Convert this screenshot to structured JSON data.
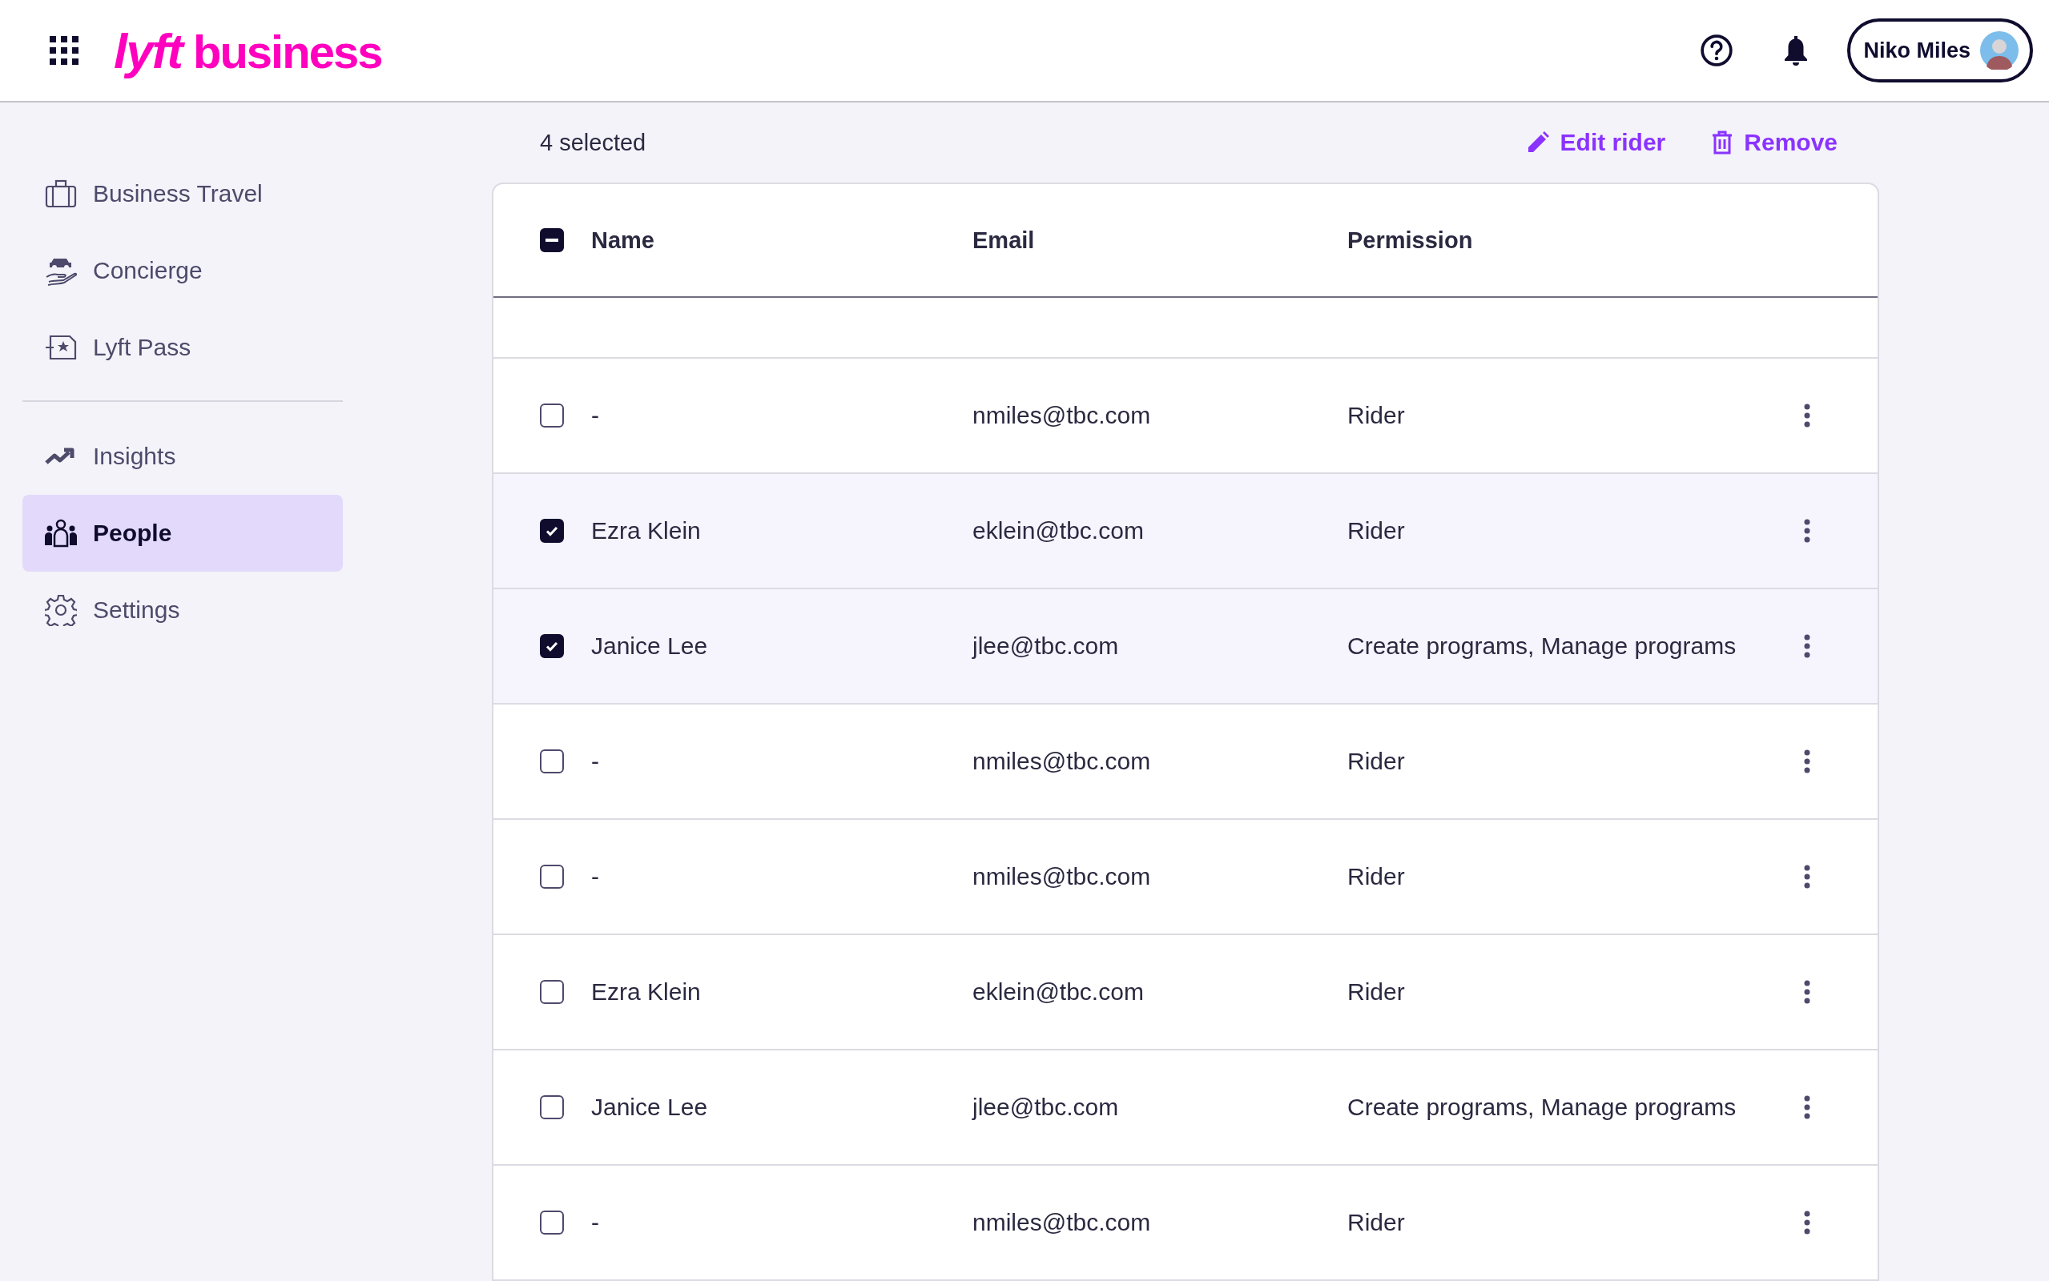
{
  "header": {
    "logo_mark": "lyft",
    "logo_word": "business",
    "user": {
      "name": "Niko Miles"
    }
  },
  "sidebar": {
    "groups": [
      [
        {
          "label": "Business Travel",
          "selected": false
        },
        {
          "label": "Concierge",
          "selected": false
        },
        {
          "label": "Lyft Pass",
          "selected": false
        }
      ],
      [
        {
          "label": "Insights",
          "selected": false
        },
        {
          "label": "People",
          "selected": true
        },
        {
          "label": "Settings",
          "selected": false
        }
      ]
    ]
  },
  "toolbar": {
    "selection_count": "4 selected",
    "actions": [
      "Edit rider",
      "Remove"
    ]
  },
  "table": {
    "select_all_indeterminate": true,
    "columns": [
      "Name",
      "Email",
      "Permission"
    ],
    "rows": [
      {
        "name": "-",
        "email": "nmiles@tbc.com",
        "permission": "Rider",
        "selected": false
      },
      {
        "name": "Ezra Klein",
        "email": "eklein@tbc.com",
        "permission": "Rider",
        "selected": true
      },
      {
        "name": "Janice Lee",
        "email": "jlee@tbc.com",
        "permission": "Create programs, Manage programs",
        "selected": true
      },
      {
        "name": "-",
        "email": "nmiles@tbc.com",
        "permission": "Rider",
        "selected": false
      },
      {
        "name": "-",
        "email": "nmiles@tbc.com",
        "permission": "Rider",
        "selected": false
      },
      {
        "name": "Ezra Klein",
        "email": "eklein@tbc.com",
        "permission": "Rider",
        "selected": false
      },
      {
        "name": "Janice Lee",
        "email": "jlee@tbc.com",
        "permission": "Create programs, Manage programs",
        "selected": false
      },
      {
        "name": "-",
        "email": "nmiles@tbc.com",
        "permission": "Rider",
        "selected": false
      }
    ]
  }
}
